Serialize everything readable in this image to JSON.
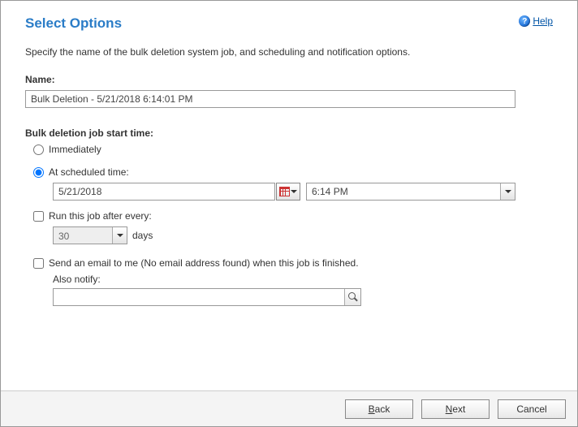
{
  "header": {
    "title": "Select Options",
    "help_label": "Help"
  },
  "description": "Specify the name of the bulk deletion system job, and scheduling and notification options.",
  "name": {
    "label": "Name:",
    "value": "Bulk Deletion - 5/21/2018 6:14:01 PM"
  },
  "start_time": {
    "label": "Bulk deletion job start time:",
    "immediate_label": "Immediately",
    "scheduled_label": "At scheduled time:",
    "date_value": "5/21/2018",
    "time_value": "6:14 PM"
  },
  "recurrence": {
    "label": "Run this job after every:",
    "value": "30",
    "unit": "days"
  },
  "notify": {
    "email_label": "Send an email to me (No email address found) when this job is finished.",
    "also_label": "Also notify:",
    "value": ""
  },
  "footer": {
    "back": "Back",
    "next": "Next",
    "cancel": "Cancel"
  }
}
